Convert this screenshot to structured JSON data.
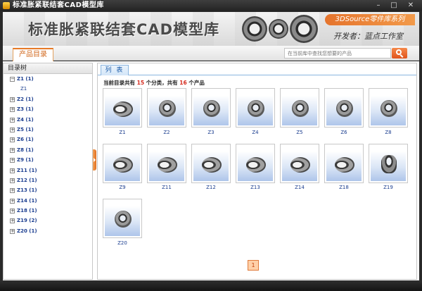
{
  "window": {
    "title": "标准胀紧联结套CAD模型库",
    "min": "–",
    "max": "□",
    "close": "✕"
  },
  "banner": {
    "product_title": "标准胀紧联结套CAD模型库",
    "series": "3DSource零件库系列",
    "developer": "开发者：蓝点工作室"
  },
  "tabs": {
    "catalog": "产品目录"
  },
  "search": {
    "placeholder": "在当前库中查找您想要的产品"
  },
  "sidebar": {
    "header": "目录树",
    "items": [
      {
        "label": "Z1 (1)",
        "expanded": true
      },
      {
        "label": "Z1",
        "child": true
      },
      {
        "label": "Z2 (1)"
      },
      {
        "label": "Z3 (1)"
      },
      {
        "label": "Z4 (1)"
      },
      {
        "label": "Z5 (1)"
      },
      {
        "label": "Z6 (1)"
      },
      {
        "label": "Z8 (1)"
      },
      {
        "label": "Z9 (1)"
      },
      {
        "label": "Z11 (1)"
      },
      {
        "label": "Z12 (1)"
      },
      {
        "label": "Z13 (1)"
      },
      {
        "label": "Z14 (1)"
      },
      {
        "label": "Z18 (1)"
      },
      {
        "label": "Z19 (2)"
      },
      {
        "label": "Z20 (1)"
      }
    ]
  },
  "main": {
    "tab": "列 表",
    "summary": {
      "prefix": "当前目录共有 ",
      "categories": "15",
      "middle": " 个分类，共有 ",
      "products": "16",
      "suffix": " 个产品"
    },
    "products": [
      "Z1",
      "Z2",
      "Z3",
      "Z4",
      "Z5",
      "Z6",
      "Z8",
      "Z9",
      "Z11",
      "Z12",
      "Z13",
      "Z14",
      "Z18",
      "Z19",
      "Z20"
    ],
    "page": "1"
  }
}
